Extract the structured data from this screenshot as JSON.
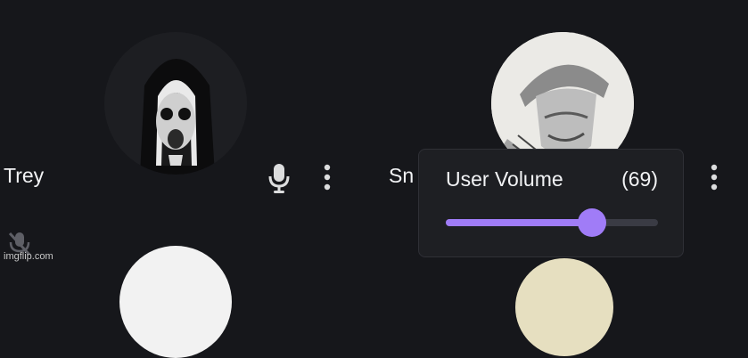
{
  "participants": [
    {
      "name": "Trey",
      "avatar_icon": "nun-mask-avatar",
      "mic_icon": "microphone-icon"
    },
    {
      "name": "Sn",
      "avatar_icon": "freddy-sketch-avatar"
    }
  ],
  "volume_popover": {
    "title": "User Volume",
    "value_label": "(69)",
    "value": 69,
    "fill_fraction": 0.69,
    "accent_color": "#a07cf7"
  },
  "watermark": "imgflip.com"
}
